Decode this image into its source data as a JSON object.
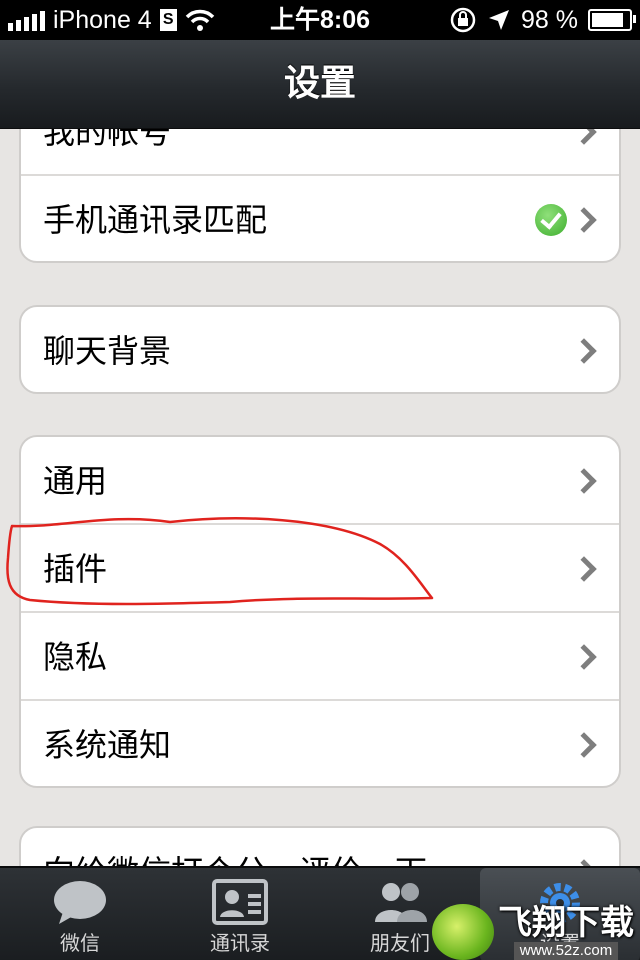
{
  "status_bar": {
    "carrier": "iPhone 4",
    "carrier_badge": "S",
    "time": "上午8:06",
    "battery_percent": "98 %",
    "battery_level": 0.98
  },
  "nav": {
    "title": "设置"
  },
  "groups": [
    {
      "cells": [
        {
          "label": "我的帐号"
        },
        {
          "label": "手机通讯录匹配",
          "status": "check"
        }
      ]
    },
    {
      "cells": [
        {
          "label": "聊天背景"
        }
      ]
    },
    {
      "cells": [
        {
          "label": "通用"
        },
        {
          "label": "插件"
        },
        {
          "label": "隐私"
        },
        {
          "label": "系统通知"
        }
      ]
    },
    {
      "cells": [
        {
          "label": "向给微信打个分，评价一下"
        }
      ]
    }
  ],
  "tabs": [
    {
      "label": "微信",
      "icon": "chat-bubble-icon"
    },
    {
      "label": "通讯录",
      "icon": "contact-card-icon"
    },
    {
      "label": "朋友们",
      "icon": "friends-icon"
    },
    {
      "label": "设置",
      "icon": "gear-icon",
      "active": true
    }
  ],
  "watermark": {
    "brand": "飞翔下载",
    "url": "www.52z.com"
  },
  "colors": {
    "annotation": "#e0231e",
    "check_badge": "#4bb83a",
    "background": "#e7e5e3"
  }
}
